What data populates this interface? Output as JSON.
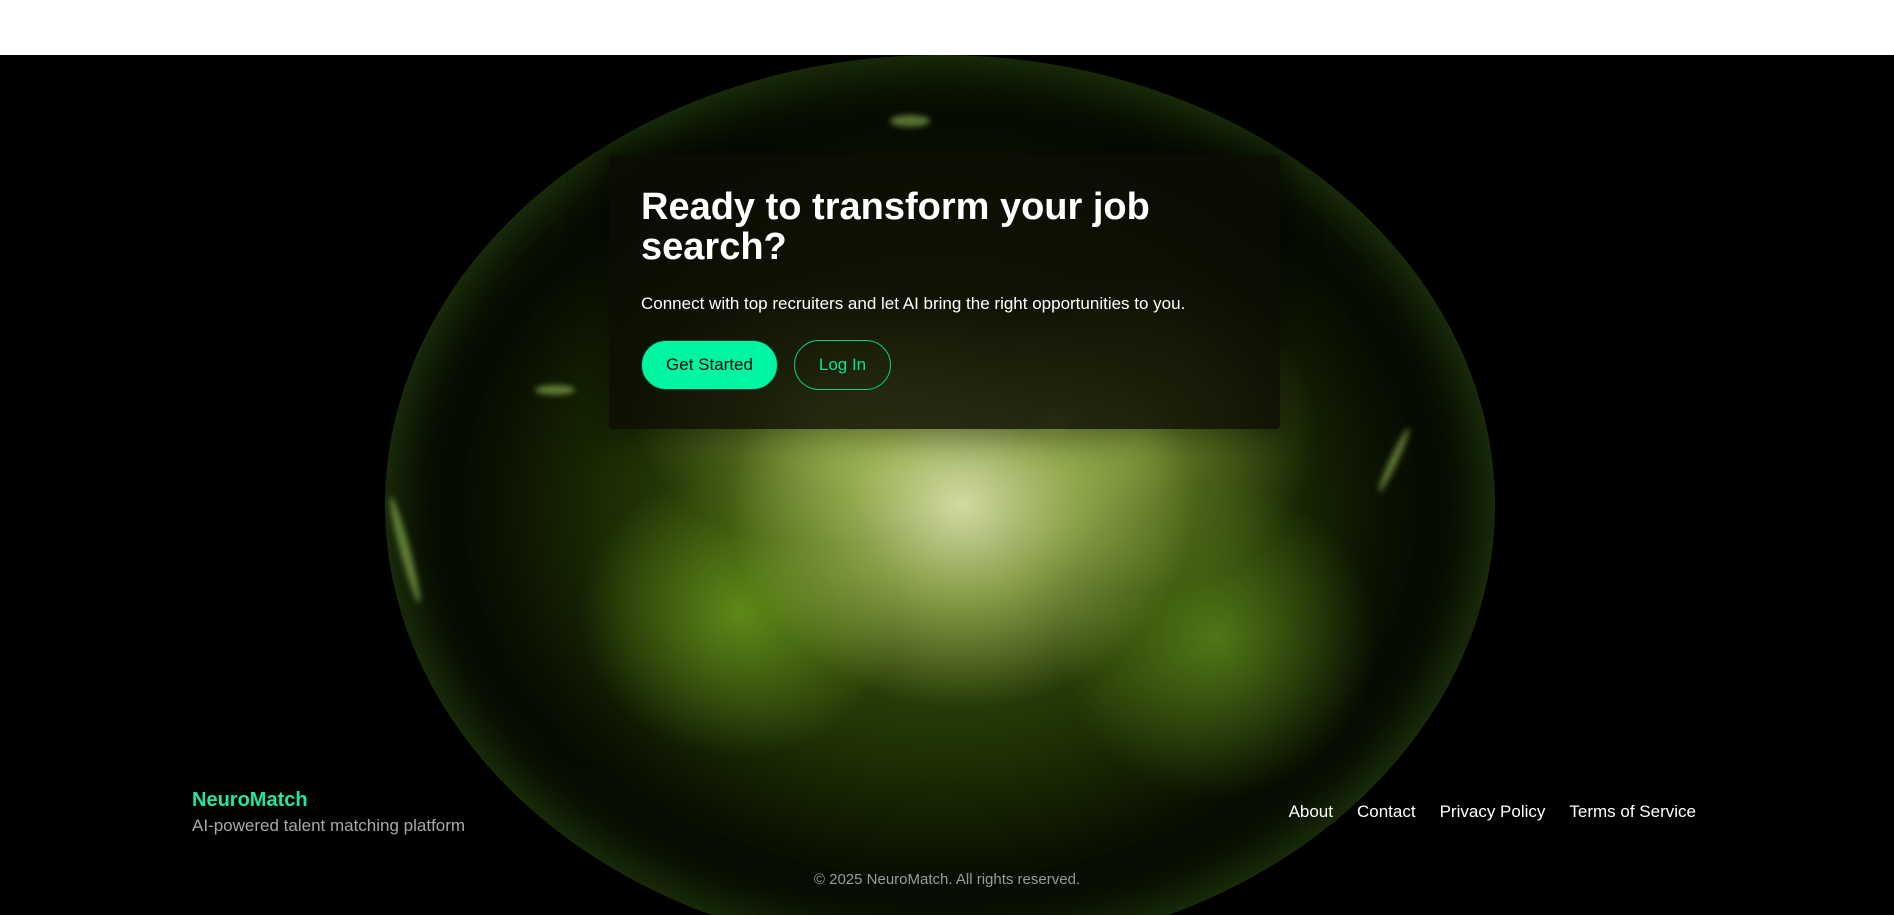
{
  "hero": {
    "title": "Ready to transform your job search?",
    "subtitle": "Connect with top recruiters and let AI bring the right opportunities to you.",
    "primary_button": "Get Started",
    "secondary_button": "Log In"
  },
  "footer": {
    "brand_name": "NeuroMatch",
    "tagline": "AI-powered talent matching platform",
    "links": [
      "About",
      "Contact",
      "Privacy Policy",
      "Terms of Service"
    ],
    "copyright": "© 2025 NeuroMatch. All rights reserved."
  },
  "colors": {
    "accent": "#00f5a0",
    "brand_text": "#1ee8a0",
    "background": "#000000",
    "top_bar": "#ffffff"
  }
}
